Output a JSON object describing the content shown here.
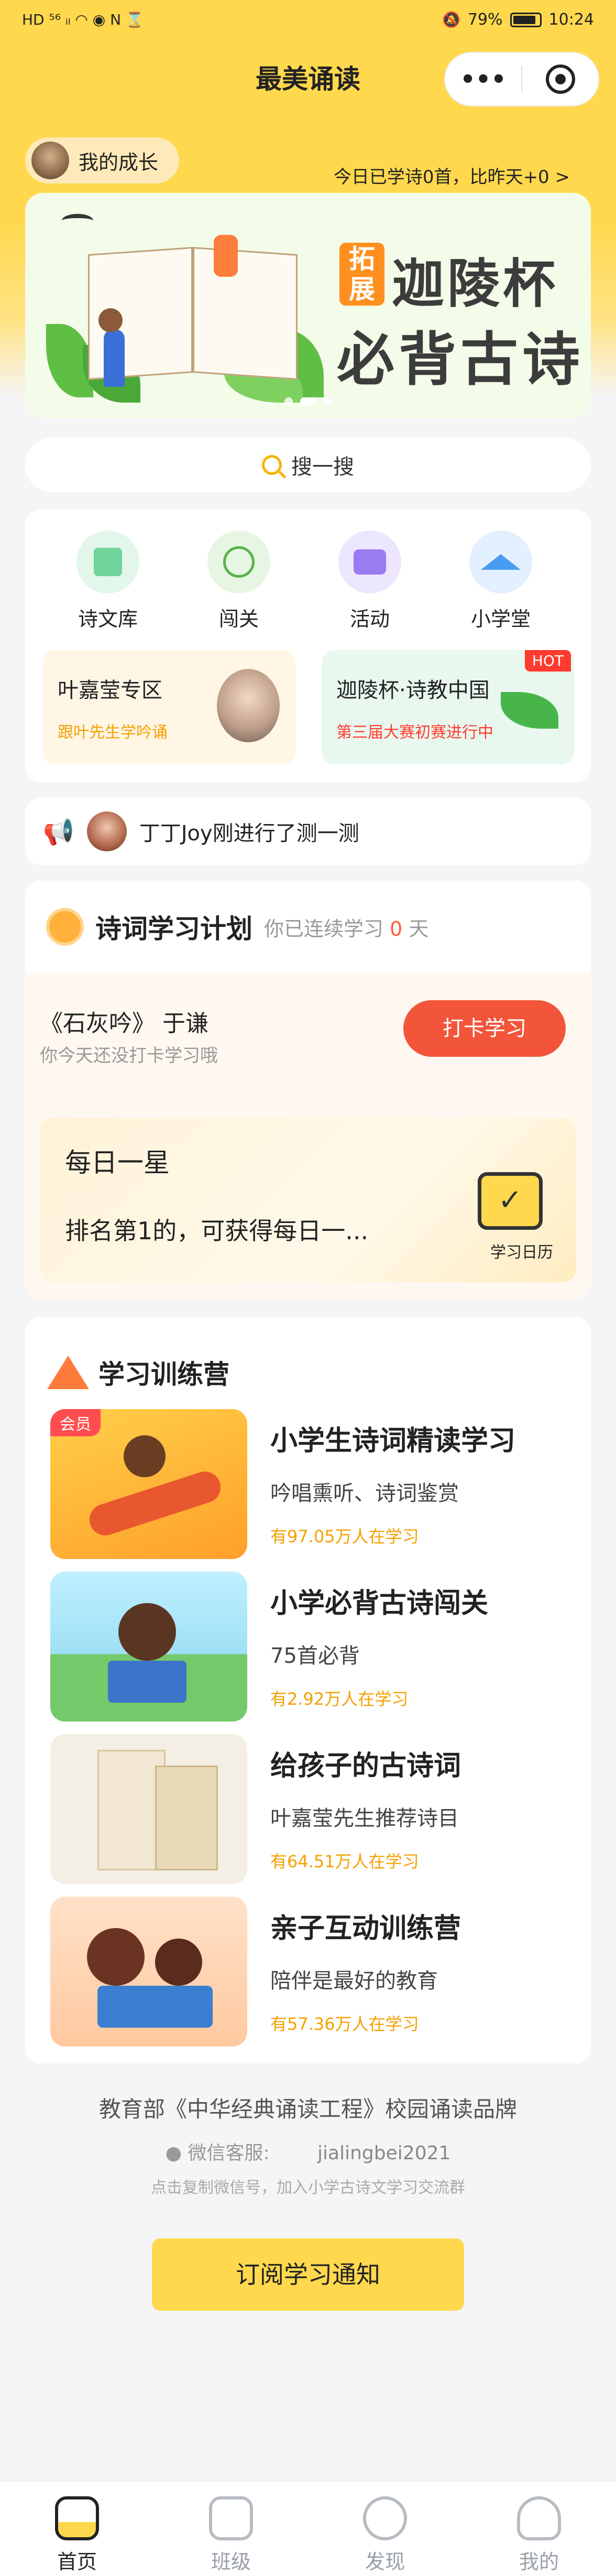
{
  "status": {
    "left": "HD ⁵⁶ ᵢₗ ◠ ◉ N ⌛",
    "battery": "79%",
    "time": "10:24"
  },
  "navbar": {
    "title": "最美诵读",
    "more": "•••"
  },
  "growth": {
    "label": "我的成长"
  },
  "today": {
    "text": "今日已学诗0首，比昨天+0 >"
  },
  "banner": {
    "tag": "拓展",
    "line1": "迦陵杯",
    "line2": "必背古诗"
  },
  "search": {
    "label": "搜一搜"
  },
  "nav": {
    "items": [
      {
        "label": "诗文库",
        "icon": "poetry-library-icon"
      },
      {
        "label": "闯关",
        "icon": "challenge-icon"
      },
      {
        "label": "活动",
        "icon": "activity-icon"
      },
      {
        "label": "小学堂",
        "icon": "classroom-icon"
      }
    ],
    "promo_left": {
      "title": "叶嘉莹专区",
      "sub": "跟叶先生学吟诵"
    },
    "promo_right": {
      "title": "迦陵杯·诗教中国",
      "sub": "第三届大赛初赛进行中",
      "badge": "HOT"
    }
  },
  "activity": {
    "text": "丁丁Joy刚进行了测一测"
  },
  "plan": {
    "title": "诗词学习计划",
    "sub_prefix": "你已连续学习 ",
    "days": "0",
    "sub_suffix": " 天",
    "poem": "《石灰吟》 于谦",
    "hint": "你今天还没打卡学习哦",
    "checkin": "打卡学习",
    "star_title": "每日一星",
    "star_desc": "排名第1的，可获得每日一...",
    "calendar": "学习日历"
  },
  "camp": {
    "title": "学习训练营",
    "courses": [
      {
        "title": "小学生诗词精读学习",
        "sub": "吟唱熏听、诗词鉴赏",
        "count": "有97.05万人在学习",
        "badge": "会员"
      },
      {
        "title": "小学必背古诗闯关",
        "sub": "75首必背",
        "count": "有2.92万人在学习"
      },
      {
        "title": "给孩子的古诗词",
        "sub": "叶嘉莹先生推荐诗目",
        "count": "有64.51万人在学习"
      },
      {
        "title": "亲子互动训练营",
        "sub": "陪伴是最好的教育",
        "count": "有57.36万人在学习"
      }
    ]
  },
  "footer": {
    "title": "教育部《中华经典诵读工程》校园诵读品牌",
    "service_label": "微信客服:",
    "service_id": "jialingbei2021",
    "copy_hint": "点击复制微信号，加入小学古诗文学习交流群",
    "subscribe": "订阅学习通知"
  },
  "tabs": [
    {
      "label": "首页",
      "active": true
    },
    {
      "label": "班级"
    },
    {
      "label": "发现"
    },
    {
      "label": "我的"
    }
  ],
  "colors": {
    "brand_yellow": "#ffd84d",
    "checkin_red": "#f2553a",
    "hot_red": "#ff3b30",
    "count_orange": "#f5a000"
  }
}
